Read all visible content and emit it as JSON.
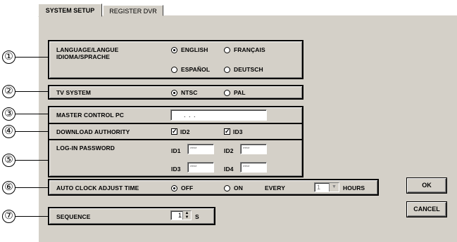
{
  "tabs": [
    {
      "label": "SYSTEM SETUP"
    },
    {
      "label": "REGISTER DVR"
    }
  ],
  "callouts": [
    "①",
    "②",
    "③",
    "④",
    "⑤",
    "⑥",
    "⑦"
  ],
  "language": {
    "label": "LANGUAGE/LANGUE\nIDIOMA/SPRACHE",
    "options": [
      "ENGLISH",
      "FRANÇAIS",
      "ESPAÑOL",
      "DEUTSCH"
    ],
    "selected": "ENGLISH"
  },
  "tv_system": {
    "label": "TV SYSTEM",
    "options": [
      "NTSC",
      "PAL"
    ],
    "selected": "NTSC"
  },
  "master_control": {
    "label": "MASTER CONTROL PC",
    "value": ".      .      ."
  },
  "download_authority": {
    "label": "DOWNLOAD AUTHORITY",
    "options": [
      {
        "label": "ID2",
        "checked": true
      },
      {
        "label": "ID3",
        "checked": true
      }
    ]
  },
  "login_password": {
    "label": "LOG-IN PASSWORD",
    "fields": [
      {
        "label": "ID1",
        "value": "****"
      },
      {
        "label": "ID2",
        "value": "****"
      },
      {
        "label": "ID3",
        "value": "****"
      },
      {
        "label": "ID4",
        "value": "****"
      }
    ]
  },
  "auto_clock": {
    "label": "AUTO CLOCK ADJUST TIME",
    "options": [
      "OFF",
      "ON"
    ],
    "selected": "OFF",
    "every_label": "EVERY",
    "hours_value": "1",
    "hours_label": "HOURS"
  },
  "sequence": {
    "label": "SEQUENCE",
    "value": "1",
    "unit": "S"
  },
  "buttons": {
    "ok": "OK",
    "cancel": "CANCEL"
  }
}
